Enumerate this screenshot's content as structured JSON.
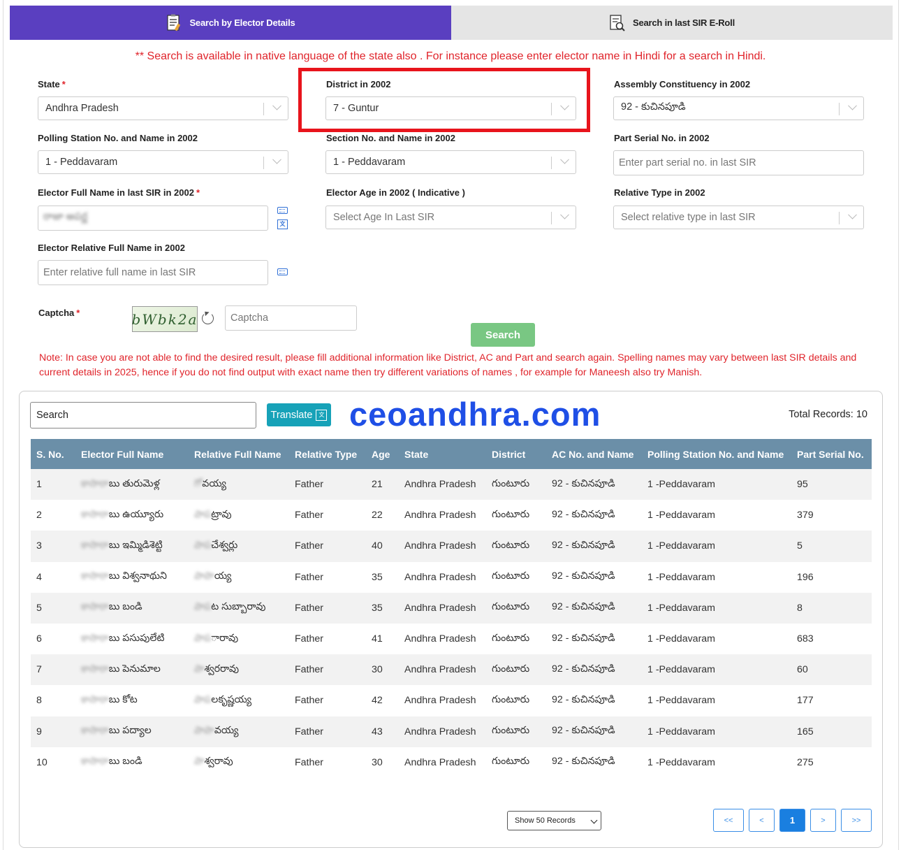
{
  "tabs": [
    {
      "label": "Search by Elector Details",
      "active": true,
      "icon": "form-list-icon"
    },
    {
      "label": "Search in last SIR E-Roll",
      "active": false,
      "icon": "document-search-icon"
    }
  ],
  "native_note": "** Search is available in native language of the state also . For instance please enter elector name in Hindi for a search in Hindi.",
  "form": {
    "state": {
      "label": "State",
      "value": "Andhra Pradesh"
    },
    "district": {
      "label": "District in 2002",
      "value": "7 - Guntur"
    },
    "assembly": {
      "label": "Assembly Constituency in 2002",
      "value": "92 - కుచినపూడి"
    },
    "polling": {
      "label": "Polling Station No. and Name in 2002",
      "value": "1 - Peddavaram"
    },
    "section": {
      "label": "Section No. and Name in 2002",
      "value": "1 - Peddavaram"
    },
    "part_serial": {
      "label": "Part Serial No. in 2002",
      "placeholder": "Enter part serial no. in last SIR"
    },
    "elector_name": {
      "label": "Elector Full Name in last SIR in 2002",
      "value": "రాజా అపర్ణ"
    },
    "elector_age": {
      "label": "Elector Age in 2002 ( Indicative )",
      "placeholder": "Select Age In Last SIR"
    },
    "relative_type": {
      "label": "Relative Type in 2002",
      "placeholder": "Select relative type in last SIR"
    },
    "relative_name": {
      "label": "Elector Relative Full Name in 2002",
      "placeholder": "Enter relative full name in last SIR"
    },
    "captcha": {
      "label": "Captcha",
      "image_text": "bWbk2a",
      "placeholder": "Captcha"
    },
    "required_mark": "*",
    "search_label": "Search"
  },
  "note": "Note: In case you are not able to find the desired result, please fill additional information like District, AC and Part and search again. Spelling names may vary between last SIR details and current details in 2025, hence if you do not find output with exact name then try different variations of names , for example for Maneesh also try Manish.",
  "results": {
    "search_value": "Search",
    "translate_label": "Translate",
    "watermark": "ceoandhra.com",
    "total_records": "Total Records: 10",
    "columns": [
      "S. No.",
      "Elector Full Name",
      "Relative Full Name",
      "Relative Type",
      "Age",
      "State",
      "District",
      "AC No. and Name",
      "Polling Station No. and Name",
      "Part Serial No."
    ],
    "rows": [
      {
        "sno": "1",
        "name_blur": "కాసారా",
        "name": "బు తురుమెళ్ల",
        "rel_blur": "గో",
        "rel": "వయ్య",
        "type": "Father",
        "age": "21",
        "state": "Andhra Pradesh",
        "district": "గుంటూరు",
        "ac": "92 - కుచినపూడి",
        "ps": "1 -Peddavaram",
        "part": "95"
      },
      {
        "sno": "2",
        "name_blur": "కాసారా",
        "name": "బు ఉయ్యూరు",
        "rel_blur": "పాప",
        "rel": "ట్రావు",
        "type": "Father",
        "age": "22",
        "state": "Andhra Pradesh",
        "district": "గుంటూరు",
        "ac": "92 - కుచినపూడి",
        "ps": "1 -Peddavaram",
        "part": "379"
      },
      {
        "sno": "3",
        "name_blur": "కాసారా",
        "name": "బు ఇమ్మిడిశెట్టి",
        "rel_blur": "పాప",
        "rel": "చేశ్వర్లు",
        "type": "Father",
        "age": "40",
        "state": "Andhra Pradesh",
        "district": "గుంటూరు",
        "ac": "92 - కుచినపూడి",
        "ps": "1 -Peddavaram",
        "part": "5"
      },
      {
        "sno": "4",
        "name_blur": "కాసారా",
        "name": "బు విశ్వనాథుని",
        "rel_blur": "పాపా",
        "rel": "య్య",
        "type": "Father",
        "age": "35",
        "state": "Andhra Pradesh",
        "district": "గుంటూరు",
        "ac": "92 - కుచినపూడి",
        "ps": "1 -Peddavaram",
        "part": "196"
      },
      {
        "sno": "5",
        "name_blur": "కాసారా",
        "name": "బు బండి",
        "rel_blur": "పాప",
        "rel": "ట సుబ్బారావు",
        "type": "Father",
        "age": "35",
        "state": "Andhra Pradesh",
        "district": "గుంటూరు",
        "ac": "92 - కుచినపూడి",
        "ps": "1 -Peddavaram",
        "part": "8"
      },
      {
        "sno": "6",
        "name_blur": "కాసారా",
        "name": "బు పసుపులేటి",
        "rel_blur": "పాప",
        "rel": "ారావు",
        "type": "Father",
        "age": "41",
        "state": "Andhra Pradesh",
        "district": "గుంటూరు",
        "ac": "92 - కుచినపూడి",
        "ps": "1 -Peddavaram",
        "part": "683"
      },
      {
        "sno": "7",
        "name_blur": "కాసారా",
        "name": "బు పెనుమాల",
        "rel_blur": "పా",
        "rel": "శ్వరరావు",
        "type": "Father",
        "age": "30",
        "state": "Andhra Pradesh",
        "district": "గుంటూరు",
        "ac": "92 - కుచినపూడి",
        "ps": "1 -Peddavaram",
        "part": "60"
      },
      {
        "sno": "8",
        "name_blur": "కాసారా",
        "name": "బు కోట",
        "rel_blur": "పాప",
        "rel": "లకృష్ణయ్య",
        "type": "Father",
        "age": "42",
        "state": "Andhra Pradesh",
        "district": "గుంటూరు",
        "ac": "92 - కుచినపూడి",
        "ps": "1 -Peddavaram",
        "part": "177"
      },
      {
        "sno": "9",
        "name_blur": "కాసారా",
        "name": "బు పద్యాల",
        "rel_blur": "పాపా",
        "rel": "వయ్య",
        "type": "Father",
        "age": "43",
        "state": "Andhra Pradesh",
        "district": "గుంటూరు",
        "ac": "92 - కుచినపూడి",
        "ps": "1 -Peddavaram",
        "part": "165"
      },
      {
        "sno": "10",
        "name_blur": "కాసారా",
        "name": "బు బండి",
        "rel_blur": "పా",
        "rel": "శ్వరావు",
        "type": "Father",
        "age": "30",
        "state": "Andhra Pradesh",
        "district": "గుంటూరు",
        "ac": "92 - కుచినపూడి",
        "ps": "1 -Peddavaram",
        "part": "275"
      }
    ]
  },
  "pagination": {
    "page_size_label": "Show 50 Records",
    "first": "<<",
    "prev": "<",
    "current": "1",
    "next": ">",
    "last": ">>"
  },
  "colors": {
    "tab_active": "#5a3fc0",
    "note_red": "#e0242b",
    "search_button": "#79c783",
    "table_header": "#6b8fa8",
    "highlight_box": "#e8141c",
    "watermark": "#1f4fe6"
  }
}
